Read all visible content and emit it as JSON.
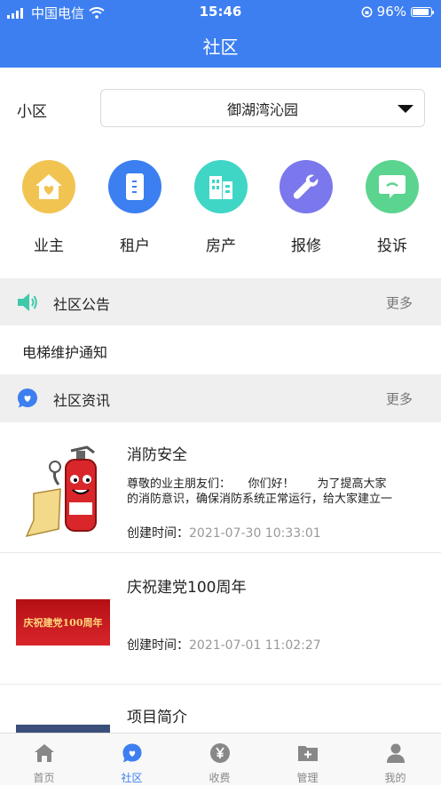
{
  "status_bar": {
    "carrier": "中国电信",
    "time": "15:46",
    "battery": "96%"
  },
  "nav": {
    "title": "社区"
  },
  "community": {
    "label": "小区",
    "selected": "御湖湾沁园"
  },
  "quick_actions": [
    {
      "label": "业主",
      "icon": "house-heart-icon",
      "color": "#f1c452"
    },
    {
      "label": "租户",
      "icon": "door-icon",
      "color": "#3c7ff0"
    },
    {
      "label": "房产",
      "icon": "building-icon",
      "color": "#3fd6c6"
    },
    {
      "label": "报修",
      "icon": "wrench-icon",
      "color": "#7b78ed"
    },
    {
      "label": "投诉",
      "icon": "message-icon",
      "color": "#5bd48f"
    }
  ],
  "announcements": {
    "title": "社区公告",
    "more": "更多",
    "items": [
      "电梯维护通知"
    ]
  },
  "news": {
    "title": "社区资讯",
    "more": "更多",
    "time_label": "创建时间：",
    "items": [
      {
        "title": "消防安全",
        "summary_line1": "尊敬的业主朋友们：　　你们好！　　为了提高大家",
        "summary_line2": "的消防意识，确保消防系统正常运行，给大家建立一",
        "time": "2021-07-30 10:33:01"
      },
      {
        "title": "庆祝建党100周年",
        "banner_text": "庆祝建党100周年",
        "time": "2021-07-01 11:02:27"
      },
      {
        "title": "项目简介"
      }
    ]
  },
  "tabs": [
    {
      "label": "首页",
      "icon": "home-icon",
      "active": false
    },
    {
      "label": "社区",
      "icon": "community-heart-icon",
      "active": true
    },
    {
      "label": "收费",
      "icon": "yen-icon",
      "active": false
    },
    {
      "label": "管理",
      "icon": "folder-plus-icon",
      "active": false
    },
    {
      "label": "我的",
      "icon": "user-icon",
      "active": false
    }
  ],
  "colors": {
    "primary": "#3d7ff0",
    "section_bg": "#efefef",
    "muted": "#999999"
  }
}
